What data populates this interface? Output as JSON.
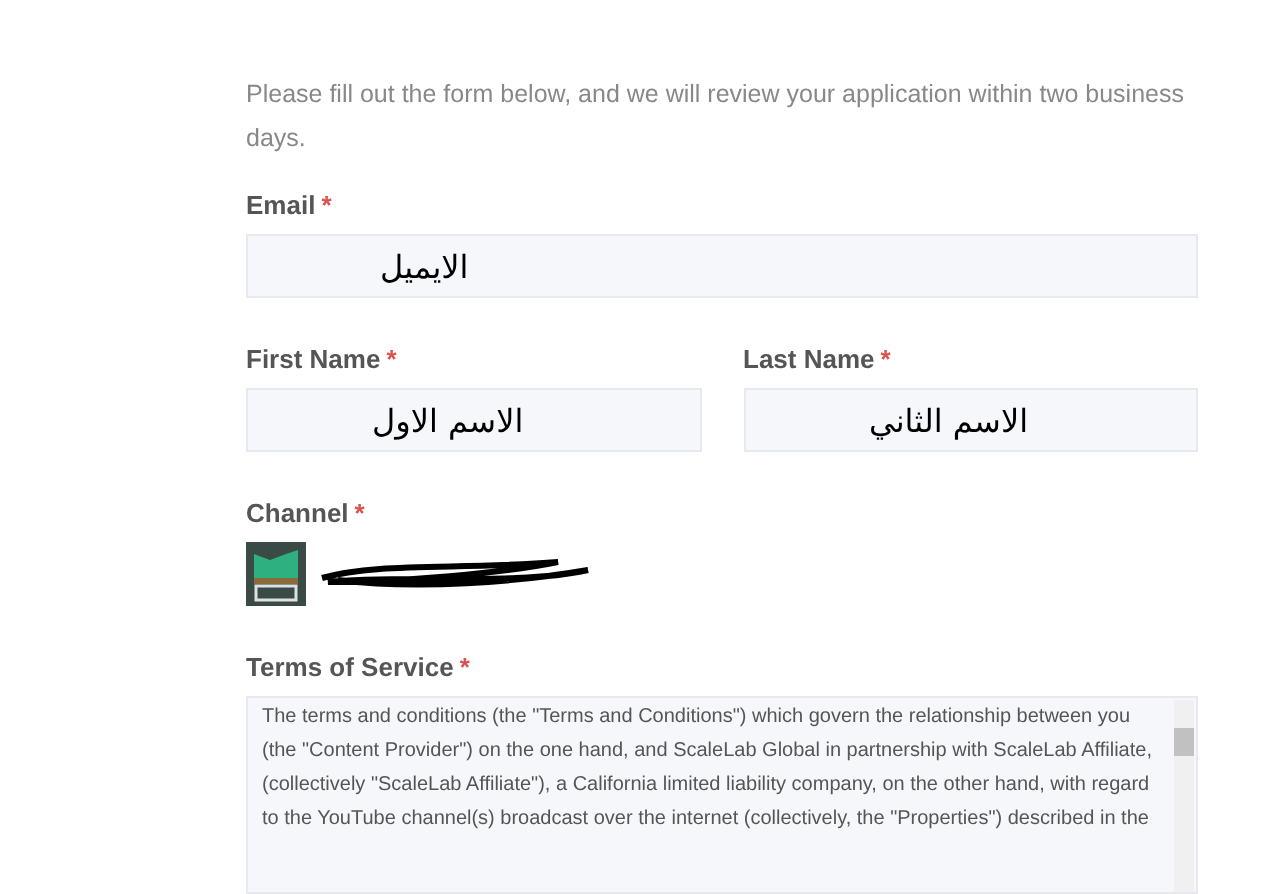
{
  "intro": "Please fill out the form below, and we will review your application within two business days.",
  "email": {
    "label": "Email",
    "required_mark": "*",
    "value": "الايميل"
  },
  "first_name": {
    "label": "First Name",
    "required_mark": "*",
    "value": "الاسم الاول"
  },
  "last_name": {
    "label": "Last Name",
    "required_mark": "*",
    "value": "الاسم الثاني"
  },
  "channel": {
    "label": "Channel",
    "required_mark": "*"
  },
  "terms": {
    "label": "Terms of Service",
    "required_mark": "*",
    "text": "The terms and conditions (the \"Terms and Conditions\") which govern the relationship between you (the \"Content Provider\") on the one hand, and ScaleLab Global in partnership with ScaleLab Affiliate, (collectively \"ScaleLab Affiliate\"), a California limited liability company, on the other hand, with regard to the YouTube channel(s) broadcast over the internet (collectively, the \"Properties\") described in the"
  }
}
